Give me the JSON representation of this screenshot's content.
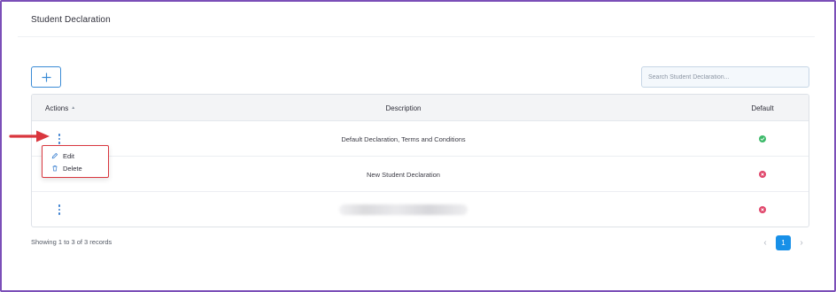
{
  "page": {
    "title": "Student Declaration"
  },
  "toolbar": {
    "add_icon": "plus-icon",
    "search_placeholder": "Search Student Declaration..."
  },
  "table": {
    "columns": {
      "actions": "Actions",
      "description": "Description",
      "default": "Default"
    },
    "sort_icon": "sort-arrow-icon",
    "rows": [
      {
        "description": "Default Declaration, Terms and Conditions",
        "default": true
      },
      {
        "description": "New Student Declaration",
        "default": false
      },
      {
        "description": "",
        "description_blurred": true,
        "default": false
      }
    ]
  },
  "row_menu": {
    "open_on_row": 1,
    "items": [
      {
        "label": "Edit",
        "icon": "pencil-icon"
      },
      {
        "label": "Delete",
        "icon": "trash-icon"
      }
    ]
  },
  "annotation": {
    "arrow_color": "#d9363e",
    "highlight_box_color": "#d9363e"
  },
  "footer": {
    "records_text": "Showing 1 to 3 of 3 records",
    "current_page": "1",
    "prev_icon": "chevron-left-icon",
    "next_icon": "chevron-right-icon"
  },
  "colors": {
    "frame_border": "#7b4fb8",
    "accent": "#1890e8",
    "status_yes": "#3dba6a",
    "status_no": "#e0456a"
  }
}
